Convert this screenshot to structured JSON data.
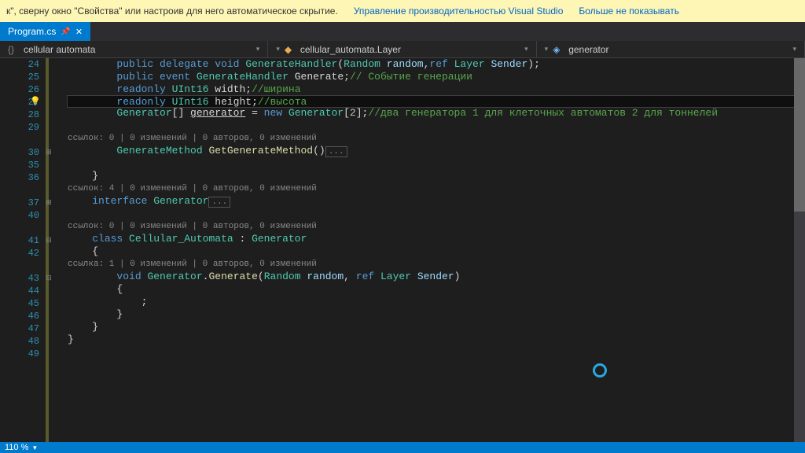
{
  "notification": {
    "text": "к\", сверну окно \"Свойства\" или настроив для него автоматическое скрытие.",
    "link1": "Управление производительностью Visual Studio",
    "link2": "Больше не показывать"
  },
  "tab": {
    "name": "Program.cs",
    "pinned": true
  },
  "breadcrumb": {
    "namespace": "cellular automata",
    "class": "cellular_automata.Layer",
    "member": "generator"
  },
  "lines": [
    24,
    25,
    26,
    27,
    28,
    29,
    30,
    35,
    36,
    37,
    40,
    41,
    42,
    43,
    44,
    45,
    46,
    47,
    48,
    49
  ],
  "codelens": {
    "l1": "ссылок: 0 | 0 изменений | 0 авторов, 0 изменений",
    "l2": "ссылок: 4 | 0 изменений | 0 авторов, 0 изменений",
    "l3": "ссылок: 0 | 0 изменений | 0 авторов, 0 изменений",
    "l4": "ссылка: 1 | 0 изменений | 0 авторов, 0 изменений"
  },
  "code": {
    "l24_a": "public",
    "l24_b": "delegate",
    "l24_c": "void",
    "l24_d": "GenerateHandler",
    "l24_e": "Random",
    "l24_f": "random",
    "l24_g": "ref",
    "l24_h": "Layer",
    "l24_i": "Sender",
    "l25_a": "public",
    "l25_b": "event",
    "l25_c": "GenerateHandler",
    "l25_d": "Generate",
    "l25_e": "// Событие генерации",
    "l26_a": "readonly",
    "l26_b": "UInt16",
    "l26_c": "width",
    "l26_d": "//ширина",
    "l27_a": "readonly",
    "l27_b": "UInt16",
    "l27_c": "height",
    "l27_d": "//высота",
    "l28_a": "Generator",
    "l28_b": "generator",
    "l28_c": "new",
    "l28_d": "Generator",
    "l28_e": "2",
    "l28_f": "//два генератора 1 для клеточных автоматов 2 для тоннелей",
    "l30_a": "GenerateMethod",
    "l30_b": "GetGenerateMethod",
    "l37_a": "interface",
    "l37_b": "Generator",
    "l41_a": "class",
    "l41_b": "Cellular_Automata",
    "l41_c": "Generator",
    "l43_a": "void",
    "l43_b": "Generator",
    "l43_c": "Generate",
    "l43_d": "Random",
    "l43_e": "random",
    "l43_f": "ref",
    "l43_g": "Layer",
    "l43_h": "Sender",
    "collapsed": "..."
  },
  "status": {
    "zoom": "110 %"
  }
}
